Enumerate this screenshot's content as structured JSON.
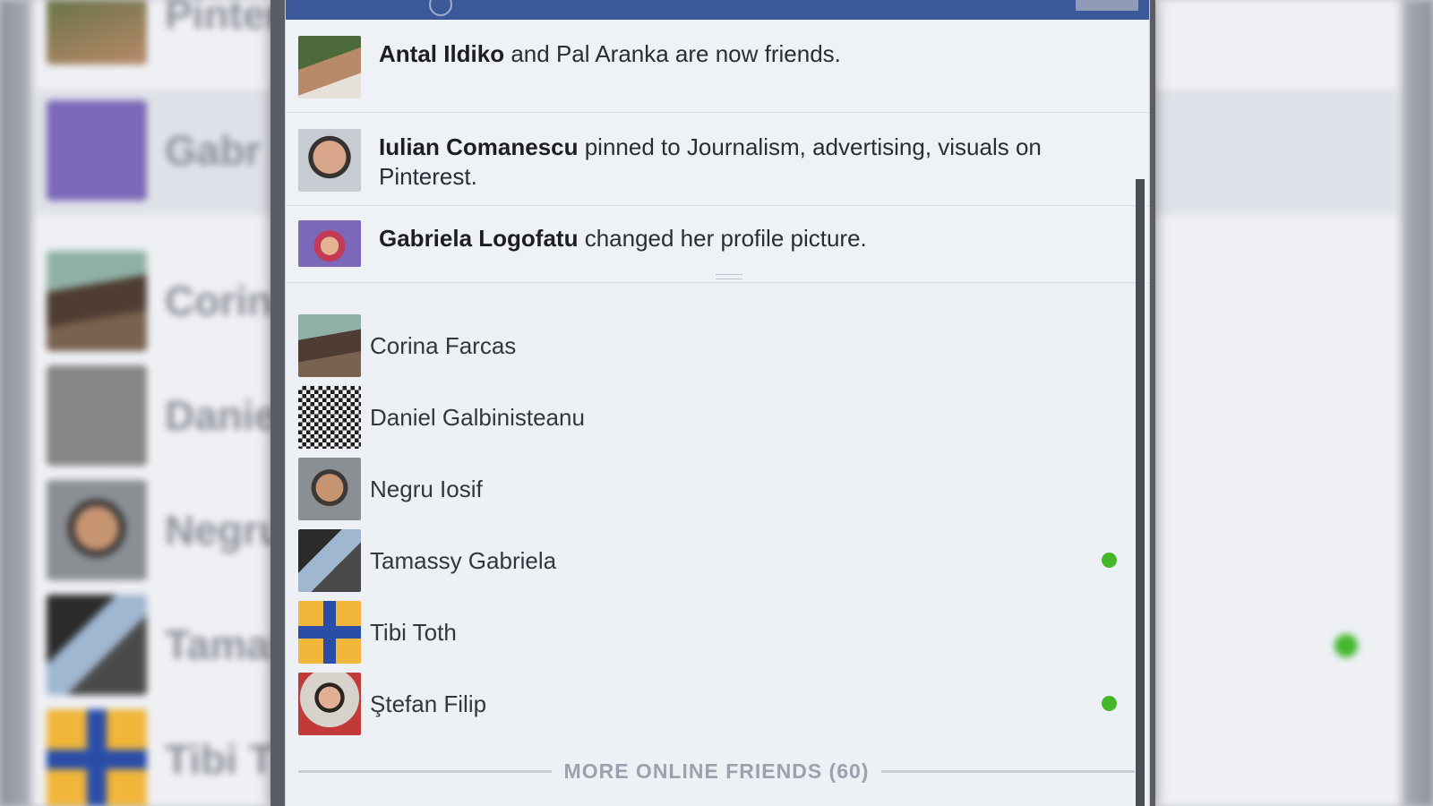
{
  "ticker": {
    "stories": [
      {
        "actor": "Antal Ildiko",
        "text": " and Pal Aranka are now friends.",
        "avatar": "antal-avatar"
      },
      {
        "actor": "Iulian Comanescu",
        "text": " pinned to Journalism, advertising, visuals on Pinterest.",
        "avatar": "iulian-avatar"
      },
      {
        "actor": "Gabriela Logofatu",
        "text": " changed her profile picture.",
        "avatar": "gabriela-avatar"
      }
    ]
  },
  "friends": [
    {
      "name": "Corina Farcas",
      "online": false
    },
    {
      "name": "Daniel Galbinisteanu",
      "online": false
    },
    {
      "name": "Negru Iosif",
      "online": false
    },
    {
      "name": "Tamassy Gabriela",
      "online": true
    },
    {
      "name": "Tibi Toth",
      "online": false
    },
    {
      "name": "Ştefan Filip",
      "online": true
    }
  ],
  "more_online": {
    "label": "MORE ONLINE FRIENDS (60)"
  },
  "background": {
    "names": [
      "Pinter",
      "Gabr",
      "Corina",
      "Daniel",
      "Negru",
      "Tamas",
      "Tibi T"
    ]
  },
  "colors": {
    "online": "#42b72a",
    "header": "#3b5998",
    "panel": "#edf0f5"
  }
}
